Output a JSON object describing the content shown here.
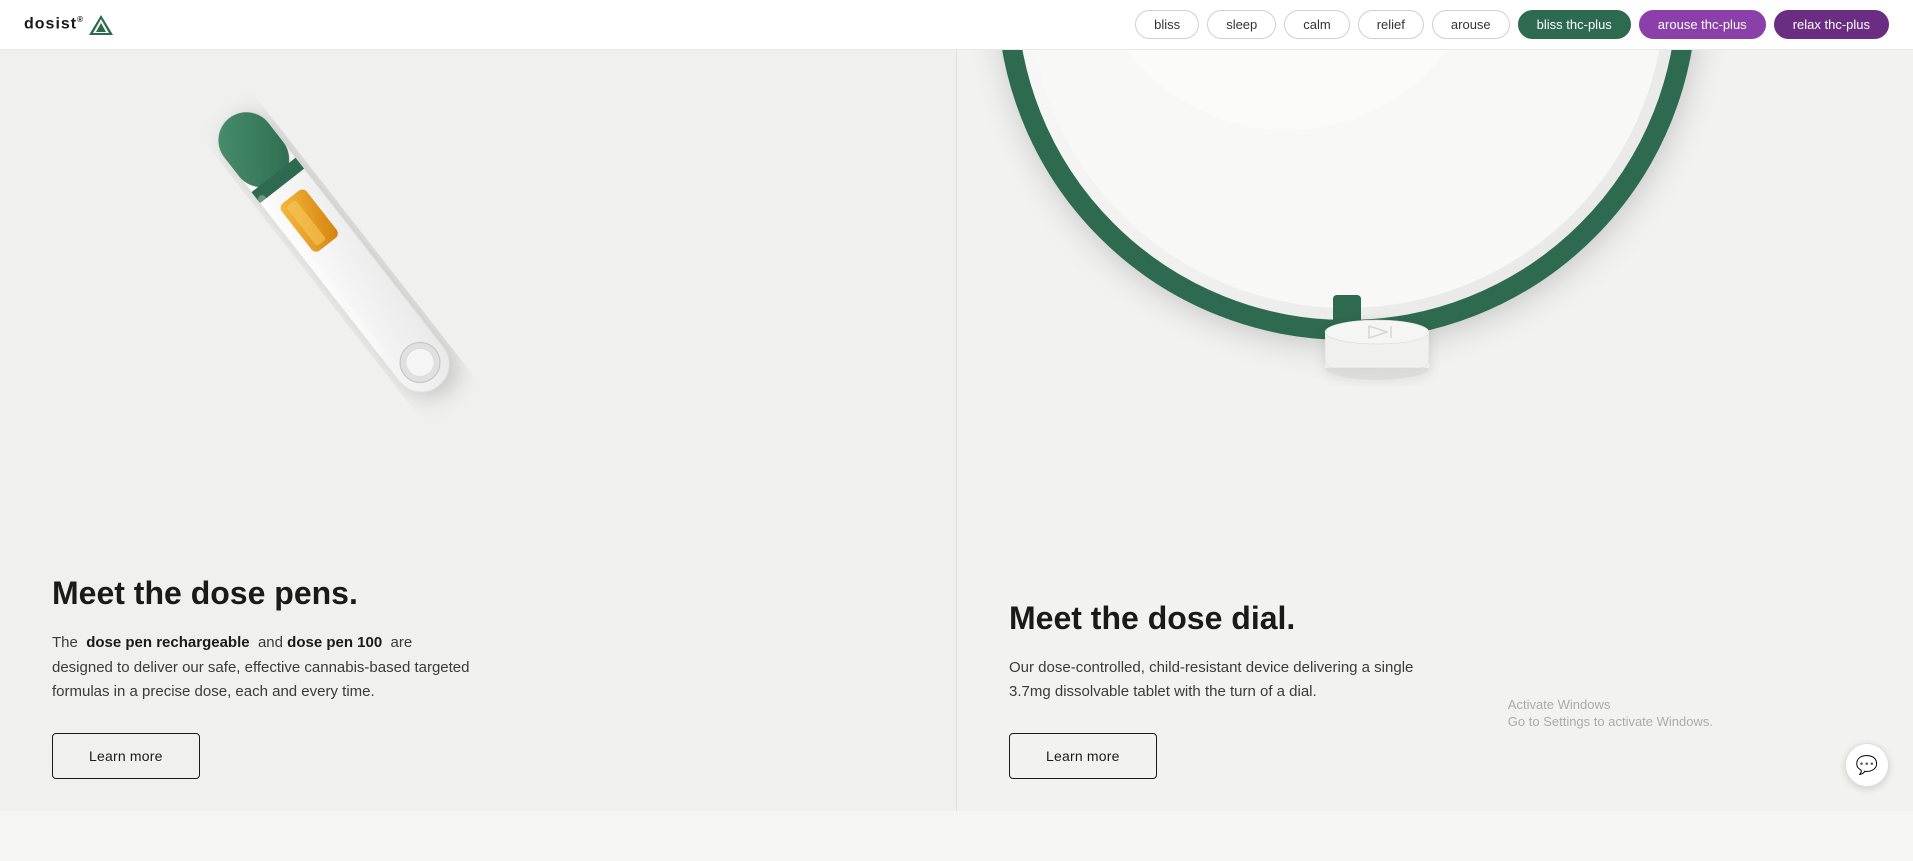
{
  "nav": {
    "logo_text": "dosist",
    "logo_symbol": "▲",
    "pills": [
      {
        "label": "bliss",
        "style": "default"
      },
      {
        "label": "sleep",
        "style": "default"
      },
      {
        "label": "calm",
        "style": "default"
      },
      {
        "label": "relief",
        "style": "default"
      },
      {
        "label": "arouse",
        "style": "default"
      },
      {
        "label": "bliss thc-plus",
        "style": "active-green"
      },
      {
        "label": "arouse thc-plus",
        "style": "active-purple"
      },
      {
        "label": "relax thc-plus",
        "style": "active-dark-purple"
      }
    ]
  },
  "panel_left": {
    "title": "Meet the dose pens.",
    "description_html": true,
    "bold1": "dose pen rechargeable",
    "and_text": "and",
    "bold2": "dose pen 100",
    "desc_suffix": "are designed to deliver our safe, effective cannabis-based targeted formulas in a precise dose, each and every time.",
    "desc_prefix": "The",
    "learn_more": "Learn more"
  },
  "panel_right": {
    "title": "Meet the dose dial.",
    "description": "Our dose-controlled, child-resistant device delivering a single 3.7mg dissolvable tablet with the turn of a dial.",
    "learn_more": "Learn more"
  },
  "activate_windows": {
    "line1": "Activate Windows",
    "line2": "Go to Settings to activate Windows."
  },
  "chat_icon": "💬"
}
